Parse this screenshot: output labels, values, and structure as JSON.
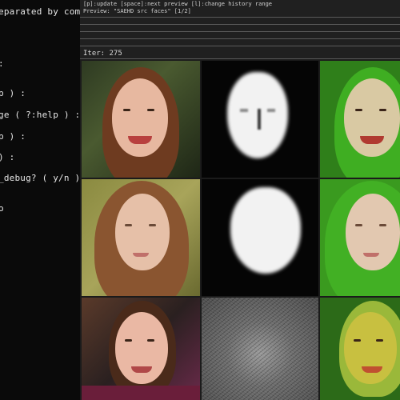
{
  "console": {
    "lines": [
      "eparated by comma",
      ":",
      "p ) :",
      "ge ( ?:help ) :",
      "p ) :",
      ") :",
      "_debug? ( y/n ) :",
      "o"
    ]
  },
  "preview": {
    "hotkeys": "[p]:update [space]:next preview [l]:change history range",
    "preview_label": "Preview: \"SAEHD src faces\" [1/2]",
    "iter_label": "Iter: 275"
  },
  "colors": {
    "mask_overlay": "#39c21c",
    "console_bg": "#0a0a0a",
    "header_bg": "#202020"
  }
}
